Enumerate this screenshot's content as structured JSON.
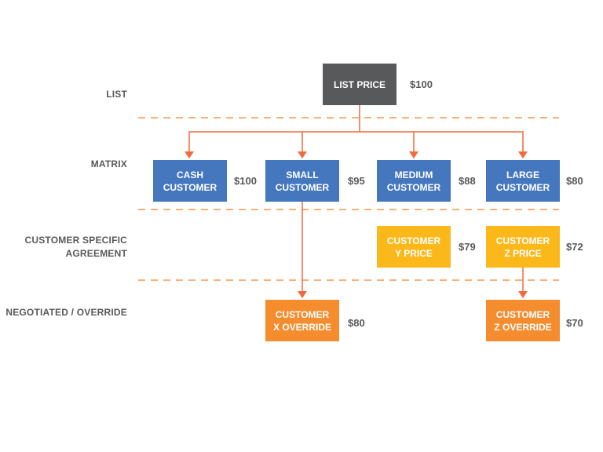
{
  "colors": {
    "list": "#58595b",
    "matrix": "#4577be",
    "agreement": "#fbb81a",
    "override": "#f58d2f",
    "arrow": "#f26a3b",
    "divider": "#f7b07a",
    "text": "#58595b"
  },
  "rows": {
    "list": "LIST",
    "matrix": "MATRIX",
    "agreement_line1": "CUSTOMER SPECIFIC",
    "agreement_line2": "AGREEMENT",
    "override": "NEGOTIATED / OVERRIDE"
  },
  "nodes": {
    "list_price": {
      "line1": "LIST PRICE",
      "line2": "",
      "price": "$100"
    },
    "cash": {
      "line1": "CASH",
      "line2": "CUSTOMER",
      "price": "$100"
    },
    "small": {
      "line1": "SMALL",
      "line2": "CUSTOMER",
      "price": "$95"
    },
    "medium": {
      "line1": "MEDIUM",
      "line2": "CUSTOMER",
      "price": "$88"
    },
    "large": {
      "line1": "LARGE",
      "line2": "CUSTOMER",
      "price": "$80"
    },
    "y_price": {
      "line1": "CUSTOMER",
      "line2": "Y PRICE",
      "price": "$79"
    },
    "z_price": {
      "line1": "CUSTOMER",
      "line2": "Z PRICE",
      "price": "$72"
    },
    "x_override": {
      "line1": "CUSTOMER",
      "line2": "X OVERRIDE",
      "price": "$80"
    },
    "z_override": {
      "line1": "CUSTOMER",
      "line2": "Z OVERRIDE",
      "price": "$70"
    }
  },
  "edges": [
    [
      "list_price",
      "cash"
    ],
    [
      "list_price",
      "small"
    ],
    [
      "list_price",
      "medium"
    ],
    [
      "list_price",
      "large"
    ],
    [
      "small",
      "x_override"
    ],
    [
      "z_price",
      "z_override"
    ]
  ]
}
